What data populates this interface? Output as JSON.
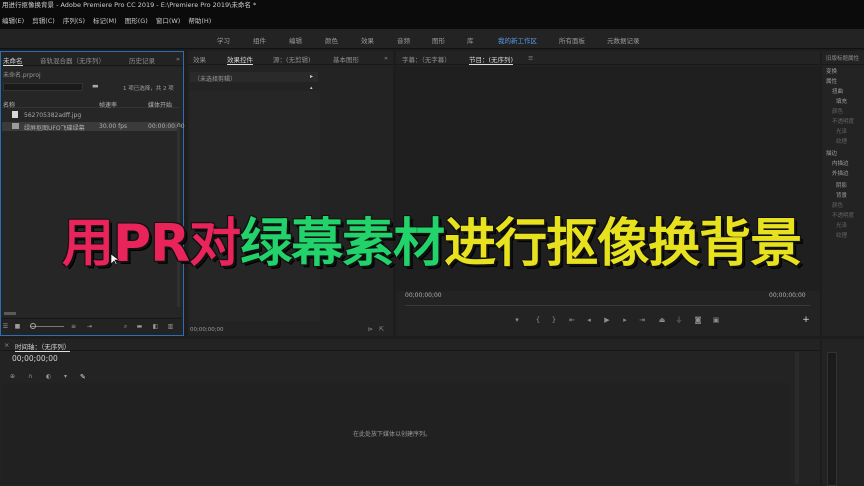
{
  "window": {
    "title": "用进行抠像换背景 - Adobe Premiere Pro CC 2019 - E:\\Premiere Pro 2019\\未命名 *"
  },
  "menu": [
    "编辑(E)",
    "剪辑(C)",
    "序列(S)",
    "标记(M)",
    "图形(G)",
    "窗口(W)",
    "帮助(H)"
  ],
  "workspaces": [
    {
      "label": "学习"
    },
    {
      "label": "组件"
    },
    {
      "label": "编辑"
    },
    {
      "label": "颜色"
    },
    {
      "label": "效果"
    },
    {
      "label": "音频"
    },
    {
      "label": "图形"
    },
    {
      "label": "库"
    },
    {
      "label": "我的新工作区",
      "active": true
    },
    {
      "label": "所有面板"
    },
    {
      "label": "元数据记录"
    }
  ],
  "project_panel": {
    "tabs": [
      "未命名",
      "音轨混合器（无序列）",
      "历史记录"
    ],
    "project_file": "未命名.prproj",
    "search_placeholder": "",
    "selection_info": "1 项已选择，共 2 项",
    "columns": [
      "名称",
      "帧速率",
      "媒体开始"
    ],
    "items": [
      {
        "name": "562705382adff.jpg",
        "fps": "",
        "start": "",
        "type": "image"
      },
      {
        "name": "绿屏抠图UFO飞碟绿幕",
        "fps": "30.00 fps",
        "start": "00:00:00:00",
        "type": "video"
      }
    ]
  },
  "effect_panel": {
    "tabs": [
      "效果",
      "效果控件",
      "源：(无剪辑)",
      "基本图形"
    ],
    "no_clip": "（未选择剪辑）",
    "timecode": "00;00;00;00"
  },
  "monitor_panel": {
    "tabs": [
      "字幕：（无字幕）",
      "节目：(无序列)"
    ],
    "timecode_left": "00;00;00;00",
    "timecode_right": "00;00;00;00"
  },
  "meta_panel": {
    "title": "旧版标题属性",
    "items": [
      "变换",
      "属性",
      "扭曲",
      "填充",
      "颜色",
      "不透明度",
      "光泽",
      "纹理",
      "描边",
      "内描边",
      "外描边",
      "阴影",
      "背景",
      "颜色",
      "不透明度",
      "光泽",
      "纹理"
    ]
  },
  "timeline_panel": {
    "title": "时间轴：（无序列）",
    "timecode": "00;00;00;00",
    "empty_hint": "在此处放下媒体以创建序列。"
  },
  "overlay": {
    "part1": "用PR对",
    "part2": "绿幕素材",
    "part3": "进行抠像换背景"
  },
  "colors": {
    "accent": "#2d6fb6",
    "workspace_active": "#5a9ce8",
    "overlay_red": "#e8245a",
    "overlay_green": "#22d26a",
    "overlay_yellow": "#e8e21e"
  }
}
